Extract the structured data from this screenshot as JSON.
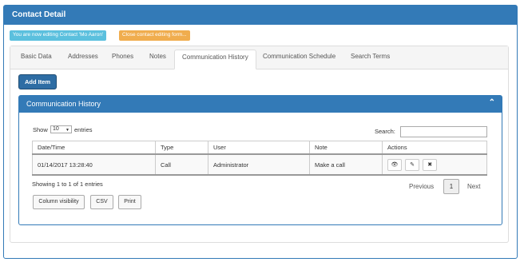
{
  "panel": {
    "title": "Contact Detail"
  },
  "notices": {
    "editing": "You are now editing Contact 'Mo Aaron'",
    "close_form": "Close contact editing form..."
  },
  "tabs": [
    {
      "label": "Basic Data"
    },
    {
      "label": "Addresses"
    },
    {
      "label": "Phones"
    },
    {
      "label": "Notes"
    },
    {
      "label": "Communication History",
      "active": true
    },
    {
      "label": "Communication Schedule"
    },
    {
      "label": "Search Terms"
    }
  ],
  "add_item": {
    "label": "Add Item"
  },
  "history": {
    "title": "Communication History",
    "show_label": "Show",
    "entries_value": "10",
    "entries_label": "entries",
    "search_label": "Search:",
    "columns": [
      "Date/Time",
      "Type",
      "User",
      "Note",
      "Actions"
    ],
    "rows": [
      {
        "datetime": "01/14/2017 13:28:40",
        "type": "Call",
        "user": "Administrator",
        "note": "Make a call"
      }
    ],
    "info": "Showing 1 to 1 of 1 entries",
    "pagination": {
      "previous": "Previous",
      "current": "1",
      "next": "Next"
    },
    "buttons": {
      "colvis": "Column visibility",
      "csv": "CSV",
      "print": "Print"
    }
  },
  "icons": {
    "view": "eye-icon",
    "edit": "edit-icon",
    "delete": "times-icon",
    "collapse": "chevron-up-icon"
  },
  "colors": {
    "primary": "#337ab7",
    "info": "#5bc0de",
    "warning": "#f0ad4e"
  }
}
